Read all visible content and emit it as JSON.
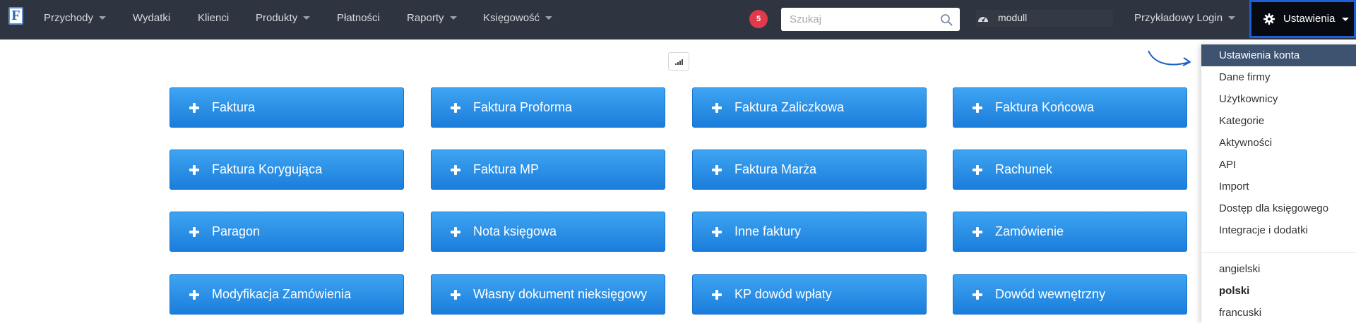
{
  "navbar": {
    "logo_letter": "F",
    "items": [
      {
        "label": "Przychody",
        "has_caret": true
      },
      {
        "label": "Wydatki",
        "has_caret": false
      },
      {
        "label": "Klienci",
        "has_caret": false
      },
      {
        "label": "Produkty",
        "has_caret": true
      },
      {
        "label": "Płatności",
        "has_caret": false
      },
      {
        "label": "Raporty",
        "has_caret": true
      },
      {
        "label": "Księgowość",
        "has_caret": true
      }
    ],
    "notification_count": "5",
    "search": {
      "placeholder": "Szukaj",
      "value": ""
    },
    "module_name": "modull",
    "login_label": "Przykładowy Login",
    "settings_label": "Ustawienia"
  },
  "documents": [
    [
      "Faktura",
      "Faktura Proforma",
      "Faktura Zaliczkowa",
      "Faktura Końcowa"
    ],
    [
      "Faktura Korygująca",
      "Faktura MP",
      "Faktura Marża",
      "Rachunek"
    ],
    [
      "Paragon",
      "Nota księgowa",
      "Inne faktury",
      "Zamówienie"
    ],
    [
      "Modyfikacja Zamówienia",
      "Własny dokument nieksięgowy",
      "KP dowód wpłaty",
      "Dowód wewnętrzny"
    ]
  ],
  "settings_menu": {
    "items": [
      {
        "label": "Ustawienia konta",
        "active": true
      },
      {
        "label": "Dane firmy"
      },
      {
        "label": "Użytkownicy"
      },
      {
        "label": "Kategorie"
      },
      {
        "label": "Aktywności"
      },
      {
        "label": "API"
      },
      {
        "label": "Import"
      },
      {
        "label": "Dostęp dla księgowego"
      },
      {
        "label": "Integracje i dodatki"
      }
    ],
    "languages": [
      {
        "label": "angielski"
      },
      {
        "label": "polski",
        "selected": true
      },
      {
        "label": "francuski"
      }
    ]
  },
  "colors": {
    "navbar_bg": "#2f3540",
    "button_blue": "#1b7ddb",
    "active_menu": "#3d536f",
    "badge_red": "#e2394b",
    "highlight_border": "#1e5fd6"
  }
}
